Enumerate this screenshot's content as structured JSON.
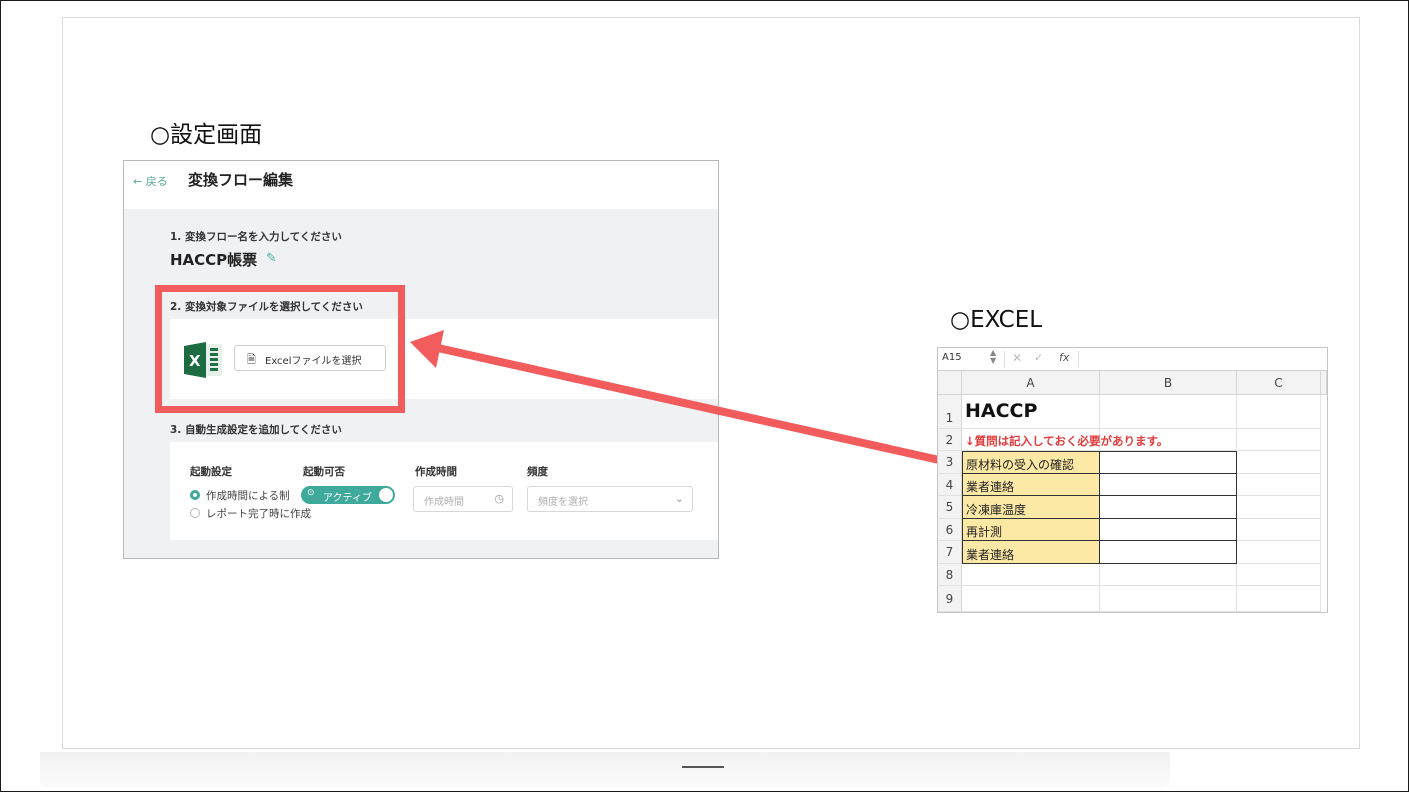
{
  "settings_section": {
    "title": "○設定画面",
    "back_label": "← 戻る",
    "page_title": "変換フロー編集",
    "step1_label": "1. 変換フロー名を入力してください",
    "flow_name": "HACCP帳票",
    "edit_icon": "pencil-icon",
    "step2_label": "2. 変換対象ファイルを選択してください",
    "excel_icon": "excel-logo-icon",
    "select_file_button": "Excelファイルを選択",
    "step3_label": "3. 自動生成設定を追加してください",
    "col_trigger": "起動設定",
    "col_enable": "起動可否",
    "col_time": "作成時間",
    "col_freq": "頻度",
    "radio_option_1": "作成時間による制",
    "radio_option_2": "レポート完了時に作成",
    "radio_selected": 1,
    "toggle_label": "アクティブ",
    "toggle_on": true,
    "time_placeholder": "作成時間",
    "freq_placeholder": "頻度を選択",
    "accent_color": "#3fa99b"
  },
  "excel_section": {
    "title": "○EXCEL",
    "name_box": "A15",
    "columns": [
      "A",
      "B",
      "C"
    ],
    "rows": [
      "1",
      "2",
      "3",
      "4",
      "5",
      "6",
      "7",
      "8",
      "9"
    ],
    "a1": "HACCP",
    "a2": "↓質問は記入しておく必要があります。",
    "items": [
      "原材料の受入の確認",
      "業者連絡",
      "冷凍庫温度",
      "再計測",
      "業者連絡"
    ],
    "note_color": "#e23b3b",
    "highlight_fill": "#fde9a6"
  },
  "annotation": {
    "highlight_color": "#f25c5c"
  }
}
